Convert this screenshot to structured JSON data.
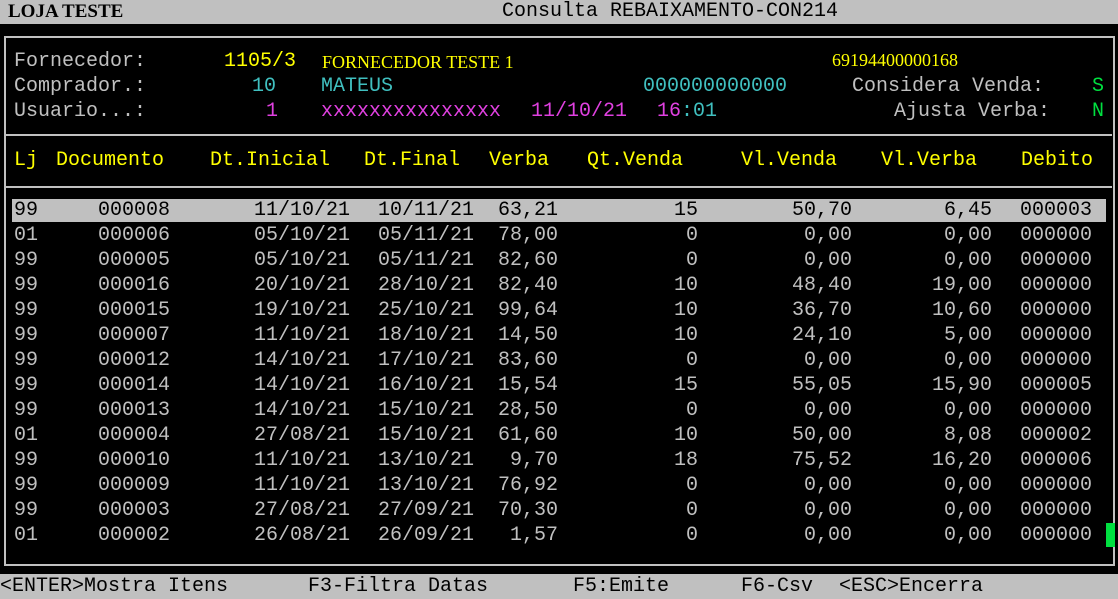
{
  "topbar": {
    "store": "LOJA TESTE",
    "title": "Consulta REBAIXAMENTO-CON214"
  },
  "info": {
    "fornecedor_label": "Fornecedor:",
    "fornecedor_code": "1105/3",
    "fornecedor_name": "FORNECEDOR TESTE 1",
    "fornecedor_doc": "69194400000168",
    "comprador_label": "Comprador.:",
    "comprador_code": "10",
    "comprador_name": "MATEUS",
    "comprador_doc": "000000000000",
    "considera_label": "Considera Venda:",
    "considera_value": "S",
    "usuario_label": "Usuario...:",
    "usuario_code": "1",
    "usuario_name": "xxxxxxxxxxxxxxx",
    "usuario_date": "11/10/21",
    "usuario_hour": "16",
    "usuario_min": ":01",
    "ajusta_label": "Ajusta Verba:",
    "ajusta_value": "N"
  },
  "table": {
    "headers": [
      "Lj",
      "Documento",
      "Dt.Inicial",
      "Dt.Final",
      "Verba",
      "Qt.Venda",
      "Vl.Venda",
      "Vl.Verba",
      "Debito"
    ],
    "selected_row": 0,
    "rows": [
      [
        "99",
        "000008",
        "11/10/21",
        "10/11/21",
        "63,21",
        "15",
        "50,70",
        "6,45",
        "000003"
      ],
      [
        "01",
        "000006",
        "05/10/21",
        "05/11/21",
        "78,00",
        "0",
        "0,00",
        "0,00",
        "000000"
      ],
      [
        "99",
        "000005",
        "05/10/21",
        "05/11/21",
        "82,60",
        "0",
        "0,00",
        "0,00",
        "000000"
      ],
      [
        "99",
        "000016",
        "20/10/21",
        "28/10/21",
        "82,40",
        "10",
        "48,40",
        "19,00",
        "000000"
      ],
      [
        "99",
        "000015",
        "19/10/21",
        "25/10/21",
        "99,64",
        "10",
        "36,70",
        "10,60",
        "000000"
      ],
      [
        "99",
        "000007",
        "11/10/21",
        "18/10/21",
        "14,50",
        "10",
        "24,10",
        "5,00",
        "000000"
      ],
      [
        "99",
        "000012",
        "14/10/21",
        "17/10/21",
        "83,60",
        "0",
        "0,00",
        "0,00",
        "000000"
      ],
      [
        "99",
        "000014",
        "14/10/21",
        "16/10/21",
        "15,54",
        "15",
        "55,05",
        "15,90",
        "000005"
      ],
      [
        "99",
        "000013",
        "14/10/21",
        "15/10/21",
        "28,50",
        "0",
        "0,00",
        "0,00",
        "000000"
      ],
      [
        "01",
        "000004",
        "27/08/21",
        "15/10/21",
        "61,60",
        "10",
        "50,00",
        "8,08",
        "000002"
      ],
      [
        "99",
        "000010",
        "11/10/21",
        "13/10/21",
        "9,70",
        "18",
        "75,52",
        "16,20",
        "000006"
      ],
      [
        "99",
        "000009",
        "11/10/21",
        "13/10/21",
        "76,92",
        "0",
        "0,00",
        "0,00",
        "000000"
      ],
      [
        "99",
        "000003",
        "27/08/21",
        "27/09/21",
        "70,30",
        "0",
        "0,00",
        "0,00",
        "000000"
      ],
      [
        "01",
        "000002",
        "26/08/21",
        "26/09/21",
        "1,57",
        "0",
        "0,00",
        "0,00",
        "000000"
      ]
    ]
  },
  "footer": {
    "enter": "<ENTER>Mostra Itens",
    "f3": "F3-Filtra Datas",
    "f5": "F5:Emite",
    "f6": "F6-Csv",
    "esc": "<ESC>Encerra"
  },
  "colors": {
    "background": "#000000",
    "frame": "#c0c0c0",
    "yellow": "#ffff00",
    "cyan": "#40c0c0",
    "magenta": "#e040e0",
    "green": "#00e040"
  }
}
